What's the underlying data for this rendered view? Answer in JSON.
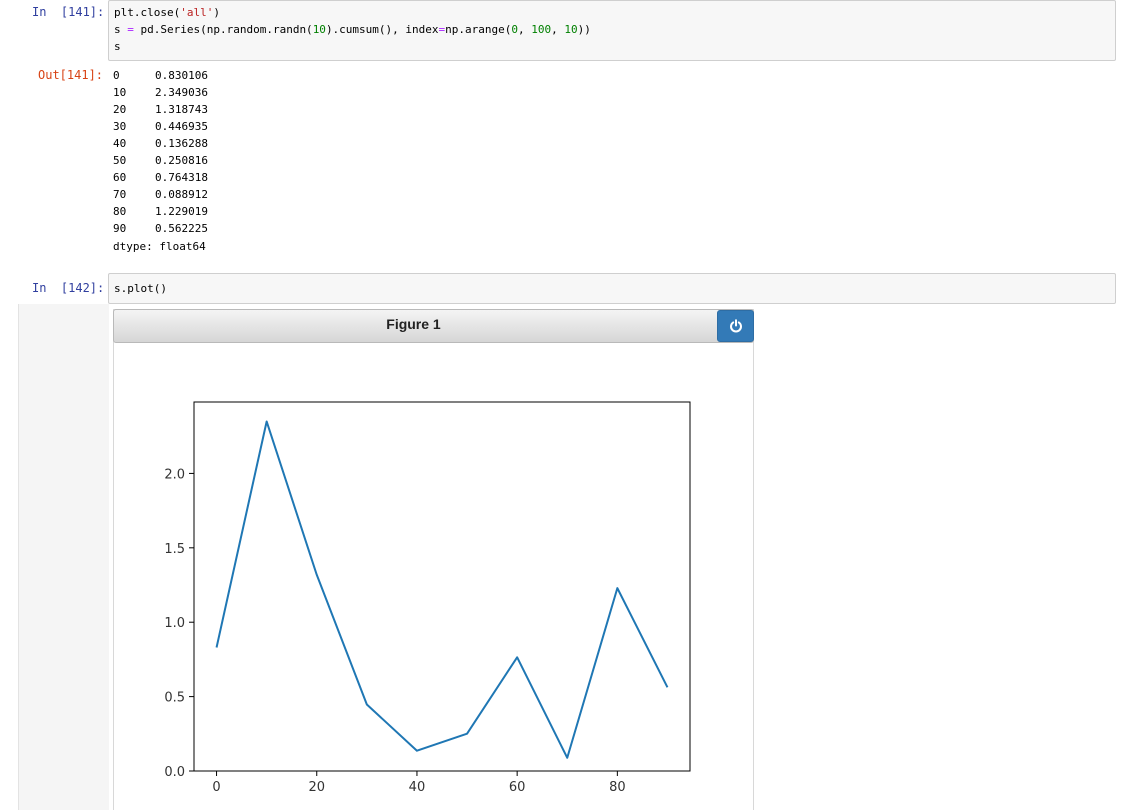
{
  "cells": {
    "in141": {
      "prompt": "In  [141]:",
      "lines": {
        "l1": {
          "a": "plt.close(",
          "b": "'all'",
          "c": ")"
        },
        "l2": {
          "a": "s ",
          "b": "=",
          "c": " pd.Series(np.random.randn(",
          "d": "10",
          "e": ").cumsum(), index",
          "f": "=",
          "g": "np.arange(",
          "h": "0",
          "i": ", ",
          "j": "100",
          "k": ", ",
          "l": "10",
          "m": "))"
        },
        "l3": "s"
      }
    },
    "out141": {
      "prompt": "Out[141]:",
      "rows": [
        {
          "index": "0",
          "value": "0.830106"
        },
        {
          "index": "10",
          "value": "2.349036"
        },
        {
          "index": "20",
          "value": "1.318743"
        },
        {
          "index": "30",
          "value": "0.446935"
        },
        {
          "index": "40",
          "value": "0.136288"
        },
        {
          "index": "50",
          "value": "0.250816"
        },
        {
          "index": "60",
          "value": "0.764318"
        },
        {
          "index": "70",
          "value": "0.088912"
        },
        {
          "index": "80",
          "value": "1.229019"
        },
        {
          "index": "90",
          "value": "0.562225"
        }
      ],
      "dtype": "dtype: float64"
    },
    "in142": {
      "prompt": "In  [142]:",
      "code": "s.plot()"
    }
  },
  "figure": {
    "title": "Figure 1",
    "power_icon": "power-icon",
    "accent_color": "#337ab7",
    "line_color": "#1f77b4"
  },
  "chart_data": {
    "type": "line",
    "x": [
      0,
      10,
      20,
      30,
      40,
      50,
      60,
      70,
      80,
      90
    ],
    "series": [
      {
        "values": [
          0.830106,
          2.349036,
          1.318743,
          0.446935,
          0.136288,
          0.250816,
          0.764318,
          0.088912,
          1.229019,
          0.562225
        ]
      }
    ],
    "xticks": [
      "0",
      "20",
      "40",
      "60",
      "80"
    ],
    "yticks": [
      "0.0",
      "0.5",
      "1.0",
      "1.5",
      "2.0"
    ],
    "xlim": [
      -4.5,
      94.5
    ],
    "ylim": [
      0.0,
      2.48
    ],
    "grid": false
  }
}
